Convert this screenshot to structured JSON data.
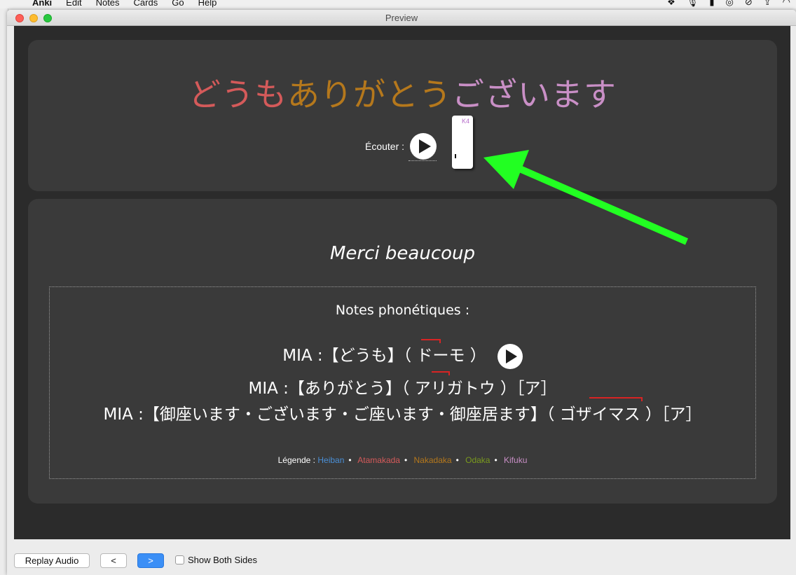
{
  "menubar": {
    "items": [
      "Anki",
      "Edit",
      "Notes",
      "Cards",
      "Go",
      "Help"
    ]
  },
  "window": {
    "title": "Preview"
  },
  "front": {
    "word_parts": [
      "どうも",
      "ありがとう",
      "ございます"
    ],
    "listen_label": "Écouter :",
    "stroke_card_label": "K4"
  },
  "back": {
    "translation": "Merci beaucoup",
    "notes_title": "Notes phonétiques :",
    "readings": [
      {
        "text": "MIA :【どうも】（ ドーモ ）"
      },
      {
        "text": "MIA :【ありがとう】（ アリガトウ ）［ア］"
      },
      {
        "text": "MIA :【御座います・ございます・ご座います・御座居ます】（ ゴザイマス ）［ア］"
      }
    ],
    "legend": {
      "label": "Légende :",
      "items": [
        "Heiban",
        "Atamakada",
        "Nakadaka",
        "Odaka",
        "Kifuku"
      ],
      "colors": [
        "#4a8fd6",
        "#d45a5a",
        "#b5781c",
        "#7a9a1e",
        "#c98fc6"
      ]
    }
  },
  "bottombar": {
    "replay_label": "Replay Audio",
    "prev_label": "<",
    "next_label": ">",
    "show_both_label": "Show Both Sides",
    "show_both_checked": false
  },
  "colors": {
    "background": "#2b2b2b",
    "panel": "#3a3a3a",
    "annotation_arrow": "#22ff22",
    "pitch_line": "#d82424"
  }
}
